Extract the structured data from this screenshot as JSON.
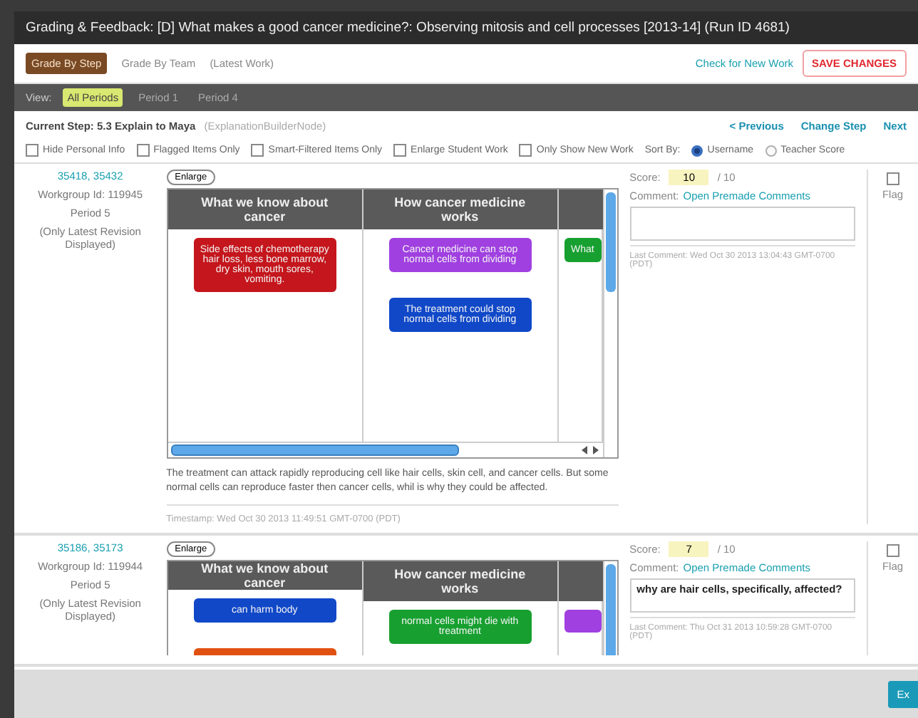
{
  "window": {
    "title": "Grading & Feedback: [D] What makes a good cancer medicine?: Observing mitosis and cell processes [2013-14] (Run ID 4681)"
  },
  "toolbar": {
    "tabs": [
      {
        "label": "Grade By Step",
        "selected": true
      },
      {
        "label": "Grade By Team",
        "selected": false
      }
    ],
    "note": "(Latest Work)",
    "check_link": "Check for New Work",
    "save_button": "SAVE CHANGES"
  },
  "periods": {
    "label": "View:",
    "items": [
      {
        "label": "All Periods",
        "selected": true
      },
      {
        "label": "Period 1",
        "selected": false
      },
      {
        "label": "Period 4",
        "selected": false
      }
    ]
  },
  "step": {
    "title": "Current Step: 5.3 Explain to Maya",
    "node": "(ExplanationBuilderNode)",
    "nav": [
      "< Previous",
      "Change Step",
      "Next"
    ]
  },
  "filters": {
    "options": [
      {
        "label": "Hide Personal Info",
        "checked": false
      },
      {
        "label": "Flagged Items Only",
        "checked": false
      },
      {
        "label": "Smart-Filtered Items Only",
        "checked": false
      },
      {
        "label": "Enlarge Student Work",
        "checked": false
      },
      {
        "label": "Only Show New Work",
        "checked": false
      }
    ],
    "sort_label": "Sort By:",
    "sort": [
      {
        "label": "Username",
        "selected": true
      },
      {
        "label": "Teacher Score",
        "selected": false
      }
    ]
  },
  "rows": [
    {
      "ids": "35418, 35432",
      "workgroup": "Workgroup Id: 119945",
      "period": "Period 5",
      "revision": "(Only Latest Revision Displayed)",
      "enlarge": "Enlarge",
      "columns": [
        {
          "heading": "What we know about cancer",
          "cards": [
            {
              "text": "Side effects of chemotherapy hair loss, less bone marrow, dry skin, mouth sores, vomiting.",
              "color": "#c4161c"
            }
          ]
        },
        {
          "heading": "How cancer medicine works",
          "cards": [
            {
              "text": "Cancer medicine can stop normal cells from dividing",
              "color": "#a040e0"
            },
            {
              "text": "The treatment could stop normal cells from dividing",
              "color": "#1048c8"
            }
          ]
        },
        {
          "cards": [
            {
              "text": "What",
              "color": "#17a030"
            }
          ]
        }
      ],
      "answer": "The treatment can attack rapidly reproducing cell like hair cells, skin cell, and cancer cells. But some normal cells can reproduce faster then cancer cells, whil is why they could be affected.",
      "timestamp": "Timestamp: Wed Oct 30 2013 11:49:51 GMT-0700 (PDT)",
      "score_label": "Score:",
      "score": "10",
      "max": "/ 10",
      "comment_label": "Comment:",
      "premade": "Open Premade Comments",
      "last_comment": "Last Comment: Wed Oct 30 2013 13:04:43 GMT-0700 (PDT)",
      "flag": "Flag",
      "flagged": false
    },
    {
      "ids": "35186, 35173",
      "workgroup": "Workgroup Id: 119944",
      "period": "Period 5",
      "revision": "(Only Latest Revision Displayed)",
      "enlarge": "Enlarge",
      "columns": [
        {
          "heading": "What we know about cancer",
          "cards": [
            {
              "text": "can harm body",
              "color": "#1048c8"
            },
            {
              "color": "#e05010"
            }
          ]
        },
        {
          "heading": "How cancer medicine works",
          "cards": [
            {
              "text": "normal cells might die with treatment",
              "color": "#17a030"
            }
          ]
        },
        {
          "cards": [
            {
              "color": "#a040e0"
            }
          ]
        }
      ],
      "score_label": "Score:",
      "score": "7",
      "max": "/ 10",
      "comment_label": "Comment:",
      "premade": "Open Premade Comments",
      "comment": "why are hair cells, specifically, affected?",
      "last_comment": "Last Comment: Thu Oct 31 2013 10:59:28 GMT-0700 (PDT)",
      "flag": "Flag",
      "flagged": false
    }
  ],
  "footer": {
    "button": "Ex"
  }
}
